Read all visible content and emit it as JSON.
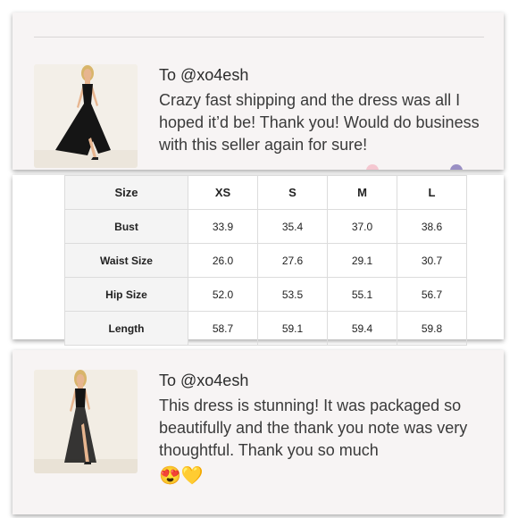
{
  "reviews": [
    {
      "to": "To @xo4esh",
      "text": "Crazy fast shipping and the dress was all I hoped it’d be! Thank you! Would do business with this seller again for sure!"
    },
    {
      "to": "To @xo4esh",
      "text": "This dress is stunning! It was packaged so beautifully and the thank you note was very thoughtful. Thank you so much",
      "emojis": "😍💛"
    }
  ],
  "size_table": {
    "corner": "Size",
    "sizes": [
      "XS",
      "S",
      "M",
      "L"
    ],
    "rows": [
      {
        "label": "Bust",
        "values": [
          "33.9",
          "35.4",
          "37.0",
          "38.6"
        ]
      },
      {
        "label": "Waist Size",
        "values": [
          "26.0",
          "27.6",
          "29.1",
          "30.7"
        ]
      },
      {
        "label": "Hip Size",
        "values": [
          "52.0",
          "53.5",
          "55.1",
          "56.7"
        ]
      },
      {
        "label": "Length",
        "values": [
          "58.7",
          "59.1",
          "59.4",
          "59.8"
        ]
      }
    ]
  },
  "colors": {
    "panel_bg": "#f7f4f4",
    "dress": "#141414",
    "skin": "#e7b58f",
    "hair": "#d8b56a",
    "thumb_bg": "#f2efe9"
  }
}
